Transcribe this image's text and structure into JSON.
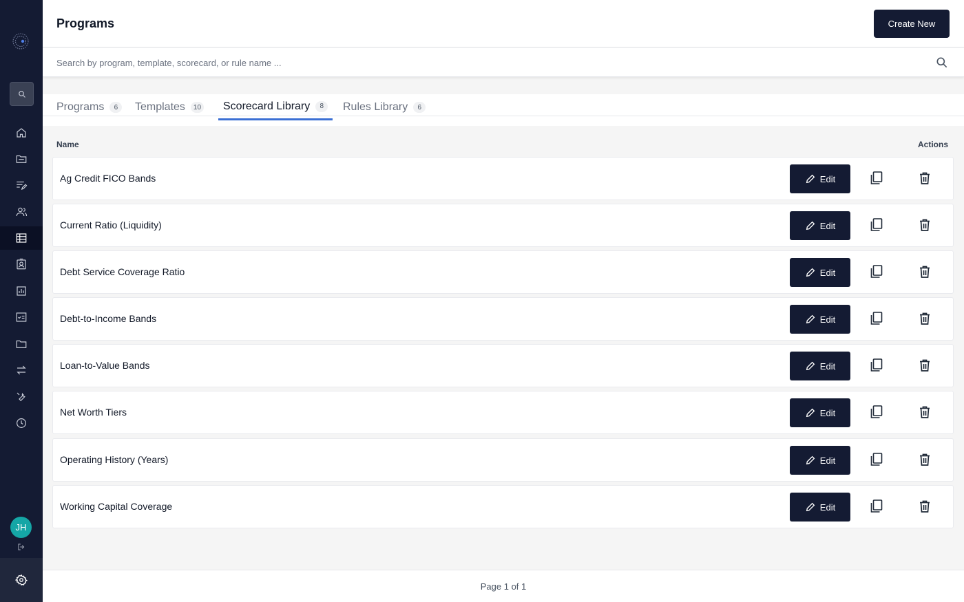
{
  "header": {
    "title": "Programs",
    "create_label": "Create New"
  },
  "search": {
    "placeholder": "Search by program, template, scorecard, or rule name ..."
  },
  "sidebar": {
    "items": [
      {
        "name": "home-icon"
      },
      {
        "name": "folder-open-icon"
      },
      {
        "name": "edit-list-icon"
      },
      {
        "name": "users-icon"
      },
      {
        "name": "table-icon"
      },
      {
        "name": "contact-card-icon"
      },
      {
        "name": "bar-chart-icon"
      },
      {
        "name": "checklist-icon"
      },
      {
        "name": "folder-icon"
      },
      {
        "name": "swap-arrows-icon"
      },
      {
        "name": "wrench-icon"
      },
      {
        "name": "history-icon"
      }
    ],
    "active_index": 4,
    "user_initials": "JH"
  },
  "tabs": [
    {
      "label": "Programs",
      "count": "6"
    },
    {
      "label": "Templates",
      "count": "10"
    },
    {
      "label": "Scorecard Library",
      "count": "8",
      "active": true
    },
    {
      "label": "Rules Library",
      "count": "6"
    }
  ],
  "table": {
    "col_name": "Name",
    "col_actions": "Actions",
    "edit_label": "Edit",
    "rows": [
      "Ag Credit FICO Bands",
      "Current Ratio (Liquidity)",
      "Debt Service Coverage Ratio",
      "Debt-to-Income Bands",
      "Loan-to-Value Bands",
      "Net Worth Tiers",
      "Operating History (Years)",
      "Working Capital Coverage"
    ]
  },
  "footer": {
    "page_label": "Page 1 of 1"
  },
  "colors": {
    "navy": "#141b33",
    "accent": "#3b6fd4",
    "avatar": "#15a6a6"
  }
}
